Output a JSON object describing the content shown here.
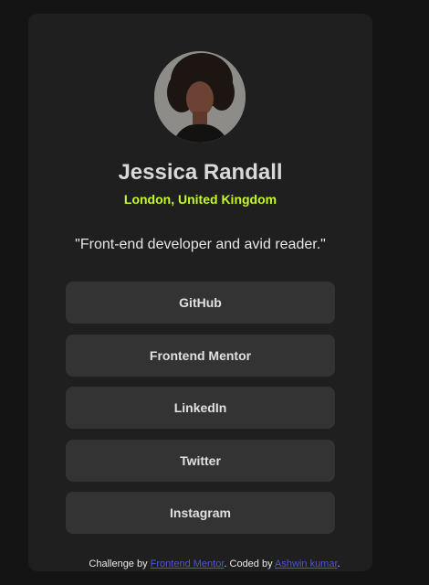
{
  "profile": {
    "name": "Jessica Randall",
    "location": "London, United Kingdom",
    "bio": "\"Front-end developer and avid reader.\""
  },
  "links": [
    {
      "label": "GitHub"
    },
    {
      "label": "Frontend Mentor"
    },
    {
      "label": "LinkedIn"
    },
    {
      "label": "Twitter"
    },
    {
      "label": "Instagram"
    }
  ],
  "footer": {
    "prefix": "Challenge by ",
    "challenge_link": "Frontend Mentor",
    "middle": ". Coded by ",
    "author_link": "Ashwin kumar",
    "suffix": "."
  },
  "colors": {
    "page_bg": "#141414",
    "card_bg": "#1f1f1f",
    "button_bg": "#333333",
    "accent": "#c4f82a",
    "link": "#4a56d8"
  }
}
